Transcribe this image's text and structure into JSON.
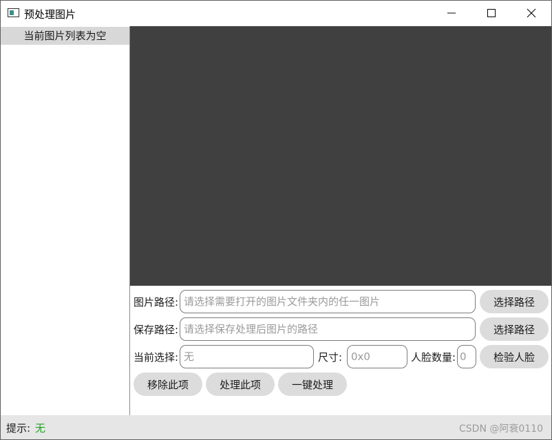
{
  "window": {
    "title": "预处理图片",
    "icon": "app-window-icon",
    "controls": [
      "minimize-icon",
      "maximize-icon",
      "close-icon"
    ]
  },
  "image_list": {
    "empty_text": "当前图片列表为空"
  },
  "form": {
    "image_path": {
      "label": "图片路径:",
      "value": "",
      "placeholder": "请选择需要打开的图片文件夹内的任一图片",
      "button": "选择路径"
    },
    "save_path": {
      "label": "保存路径:",
      "value": "",
      "placeholder": "请选择保存处理后图片的路径",
      "button": "选择路径"
    },
    "current_selection": {
      "label": "当前选择:",
      "value": "",
      "placeholder": "无"
    },
    "size": {
      "label": "尺寸:",
      "value": "",
      "placeholder": "0x0"
    },
    "face_count": {
      "label": "人脸数量:",
      "value": "",
      "placeholder": "0"
    },
    "check_face_button": "检验人脸",
    "actions": {
      "remove_item": "移除此项",
      "process_item": "处理此项",
      "process_all": "一键处理"
    }
  },
  "status": {
    "label": "提示:",
    "value": "无",
    "value_color": "#22a022"
  },
  "watermark": "CSDN @阿衰0110",
  "colors": {
    "preview_bg": "#404040",
    "list_header_bg": "#d8d8d8",
    "button_bg": "#dcdcdc",
    "statusbar_bg": "#e6e6e6"
  }
}
